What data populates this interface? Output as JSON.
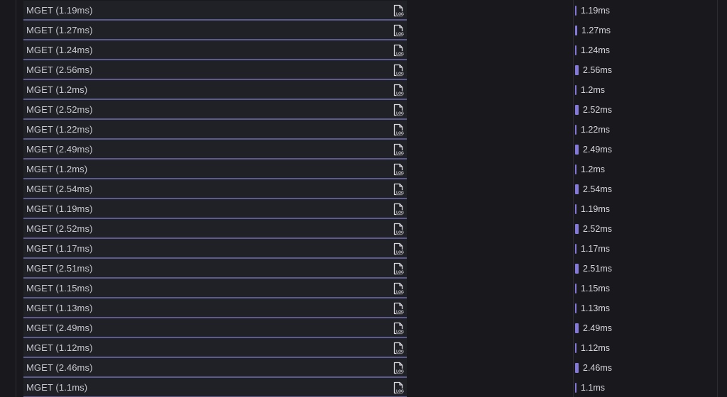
{
  "spans": [
    {
      "label": "MGET (1.19ms)",
      "value_label": "1.19ms",
      "duration_ms": 1.19
    },
    {
      "label": "MGET (1.27ms)",
      "value_label": "1.27ms",
      "duration_ms": 1.27
    },
    {
      "label": "MGET (1.24ms)",
      "value_label": "1.24ms",
      "duration_ms": 1.24
    },
    {
      "label": "MGET (2.56ms)",
      "value_label": "2.56ms",
      "duration_ms": 2.56
    },
    {
      "label": "MGET (1.2ms)",
      "value_label": "1.2ms",
      "duration_ms": 1.2
    },
    {
      "label": "MGET (2.52ms)",
      "value_label": "2.52ms",
      "duration_ms": 2.52
    },
    {
      "label": "MGET (1.22ms)",
      "value_label": "1.22ms",
      "duration_ms": 1.22
    },
    {
      "label": "MGET (2.49ms)",
      "value_label": "2.49ms",
      "duration_ms": 2.49
    },
    {
      "label": "MGET (1.2ms)",
      "value_label": "1.2ms",
      "duration_ms": 1.2
    },
    {
      "label": "MGET (2.54ms)",
      "value_label": "2.54ms",
      "duration_ms": 2.54
    },
    {
      "label": "MGET (1.19ms)",
      "value_label": "1.19ms",
      "duration_ms": 1.19
    },
    {
      "label": "MGET (2.52ms)",
      "value_label": "2.52ms",
      "duration_ms": 2.52
    },
    {
      "label": "MGET (1.17ms)",
      "value_label": "1.17ms",
      "duration_ms": 1.17
    },
    {
      "label": "MGET (2.51ms)",
      "value_label": "2.51ms",
      "duration_ms": 2.51
    },
    {
      "label": "MGET (1.15ms)",
      "value_label": "1.15ms",
      "duration_ms": 1.15
    },
    {
      "label": "MGET (1.13ms)",
      "value_label": "1.13ms",
      "duration_ms": 1.13
    },
    {
      "label": "MGET (2.49ms)",
      "value_label": "2.49ms",
      "duration_ms": 2.49
    },
    {
      "label": "MGET (1.12ms)",
      "value_label": "1.12ms",
      "duration_ms": 1.12
    },
    {
      "label": "MGET (2.46ms)",
      "value_label": "2.46ms",
      "duration_ms": 2.46
    },
    {
      "label": "MGET (1.1ms)",
      "value_label": "1.1ms",
      "duration_ms": 1.1
    }
  ],
  "row_icon": "log-file-icon",
  "icon_text": "LOG",
  "colors": {
    "background": "#19191d",
    "row_background": "#202027",
    "row_separator": "#5d5a8e",
    "bar": "#8279d8",
    "text": "#c9c9d1"
  }
}
